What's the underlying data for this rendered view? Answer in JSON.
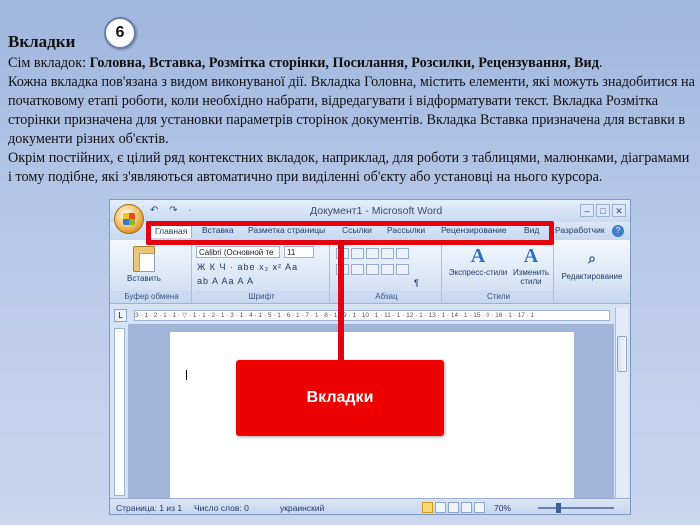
{
  "slide": {
    "title": "Вкладки",
    "badge": "6",
    "intro": "Сім вкладок: ",
    "tabs_list": "Головна, Вставка, Розмітка сторінки, Посилання, Розсилки, Рецензування, Вид",
    "intro_end": ".",
    "paragraph1": "Кожна вкладка пов'язана з видом виконуваної дії.  Вкладка Головна, містить елементи, які можуть знадобитися на початковому етапі роботи, коли необхідно набрати, відредагувати і відформатувати текст. Вкладка Розмітка сторінки призначена для установки параметрів сторінок документів. Вкладка Вставка призначена для вставки в документи різних об'єктів.",
    "paragraph2": "Окрім постійних, є цілий ряд контекстних вкладок, наприклад, для роботи з таблицями, малюнками, діаграмами і тому подібне, які з'являються автоматично при виділенні об'єкту або установці на нього курсора.",
    "callout": "Вкладки"
  },
  "word": {
    "window_title": "Документ1 - Microsoft Word",
    "quick_access": "↶ ↷ ∙",
    "tabs": [
      "Главная",
      "Вставка",
      "Разметка страницы",
      "Ссылки",
      "Рассылки",
      "Рецензирование",
      "Вид",
      "Разработчик"
    ],
    "help": "?",
    "ribbon": {
      "paste_label": "Вставить",
      "clipboard_label": "Буфер обмена",
      "font_name": "Calibri (Основной те",
      "font_size": "11",
      "font_label": "Шрифт",
      "format_row1": "Ж  К  Ч  · abe  x₂  x²  Aa",
      "format_row2": "ab  A  Aa  A  A",
      "paragraph_label": "Абзац",
      "paragraph_mark": "¶",
      "express_styles": "Экспресс-стили",
      "change_styles": "Изменить стили",
      "styles_label": "Стили",
      "editing": "Редактирование"
    },
    "ruler_ticks": "3 · 1 · 2 · 1 · 1 · ▽ · 1 · 1 · 2 · 1 · 3 · 1 · 4 · 1 · 5 · 1 · 6 · 1 · 7 · 1 · 8 · 1 · 9 · 1 · 10 · 1 · 11 · 1 · 12 · 1 · 13 · 1 · 14 · 1 · 15 · ◊ · 16 · 1 · 17 · 1",
    "status": {
      "page": "Страница: 1 из 1",
      "words": "Число слов: 0",
      "language": "украинский",
      "zoom": "70%"
    }
  }
}
